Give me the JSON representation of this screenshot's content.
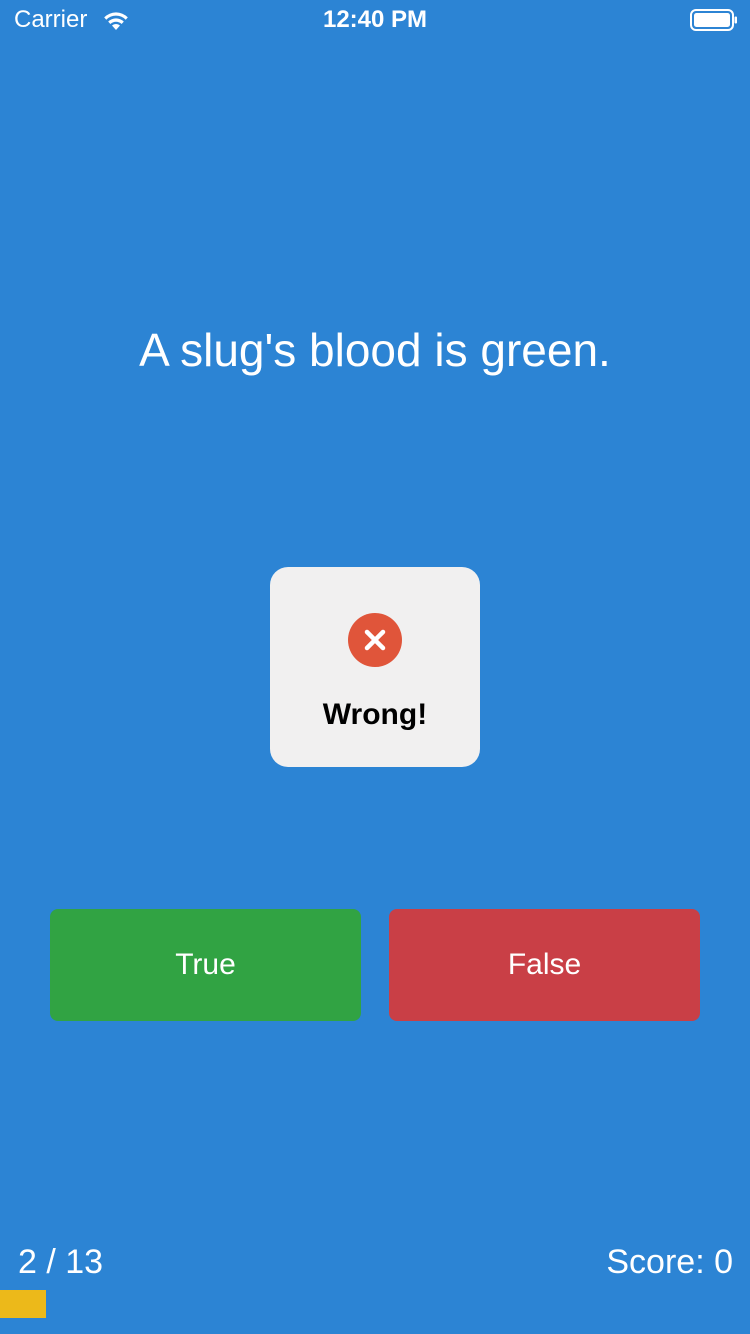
{
  "status_bar": {
    "carrier": "Carrier",
    "time": "12:40 PM",
    "wifi_icon": "wifi-icon",
    "battery_icon": "battery-icon"
  },
  "question": {
    "text": "A slug's blood is green."
  },
  "feedback": {
    "label": "Wrong!",
    "icon": "error-x-icon",
    "icon_color": "#E0553A"
  },
  "answers": {
    "true_label": "True",
    "false_label": "False"
  },
  "footer": {
    "progress_label": "2 / 13",
    "score_label": "Score: 0",
    "progress_fraction": 0.0615
  },
  "colors": {
    "background": "#2C84D4",
    "true_button": "#31A343",
    "false_button": "#C93F46",
    "progress_fill": "#ECB91A",
    "hud_background": "#F1F0F0"
  }
}
